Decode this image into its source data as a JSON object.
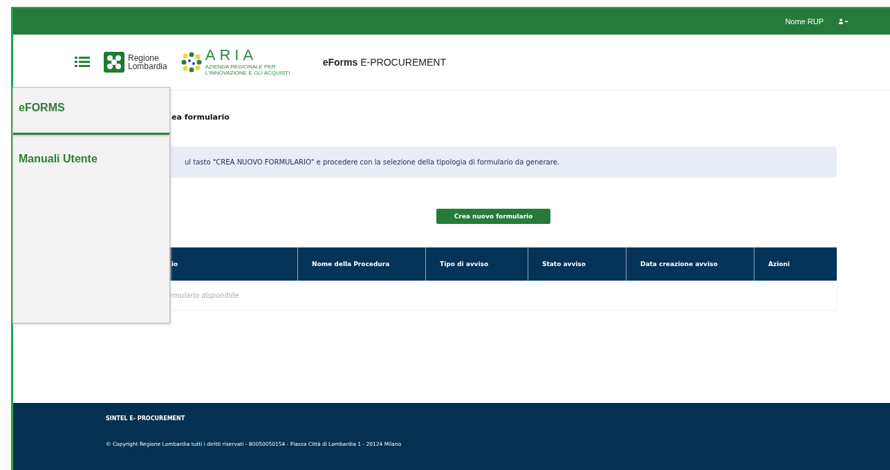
{
  "top_bar": {
    "user_name": "Nome RUP"
  },
  "header": {
    "brand_1": [
      "Regione",
      "Lombardia"
    ],
    "brand_2": "ARIA",
    "brand_2_sub": "AZIENDA REGIONALE PER L'INNOVAZIONE E GLI ACQUISTI",
    "app_title_bold": "eForms",
    "app_title": "E-PROCUREMENT"
  },
  "menu": {
    "items": [
      {
        "label": "eFORMS",
        "selected": true
      },
      {
        "label": "Manuali Utente",
        "selected": false
      }
    ]
  },
  "page": {
    "title": "ea formulario",
    "info": "ul tasto \"CREA NUOVO FORMULARIO\" e procedere con la selezione della tipologia di formulario da generare.",
    "create_button": "Crea nuovo formulario"
  },
  "table": {
    "columns": [
      "io",
      "Nome della Procedura",
      "Tipo di avviso",
      "Stato avviso",
      "Data creazione avviso",
      "Azioni"
    ],
    "empty": "rmulario disponibile"
  },
  "footer": {
    "title": "SINTEL E- PROCUREMENT",
    "copyright": "© Copyright Regione Lombardia tutti i diritti riservati - 80050050154 - Piazza Città di Lombardia 1 - 20124 Milano"
  }
}
